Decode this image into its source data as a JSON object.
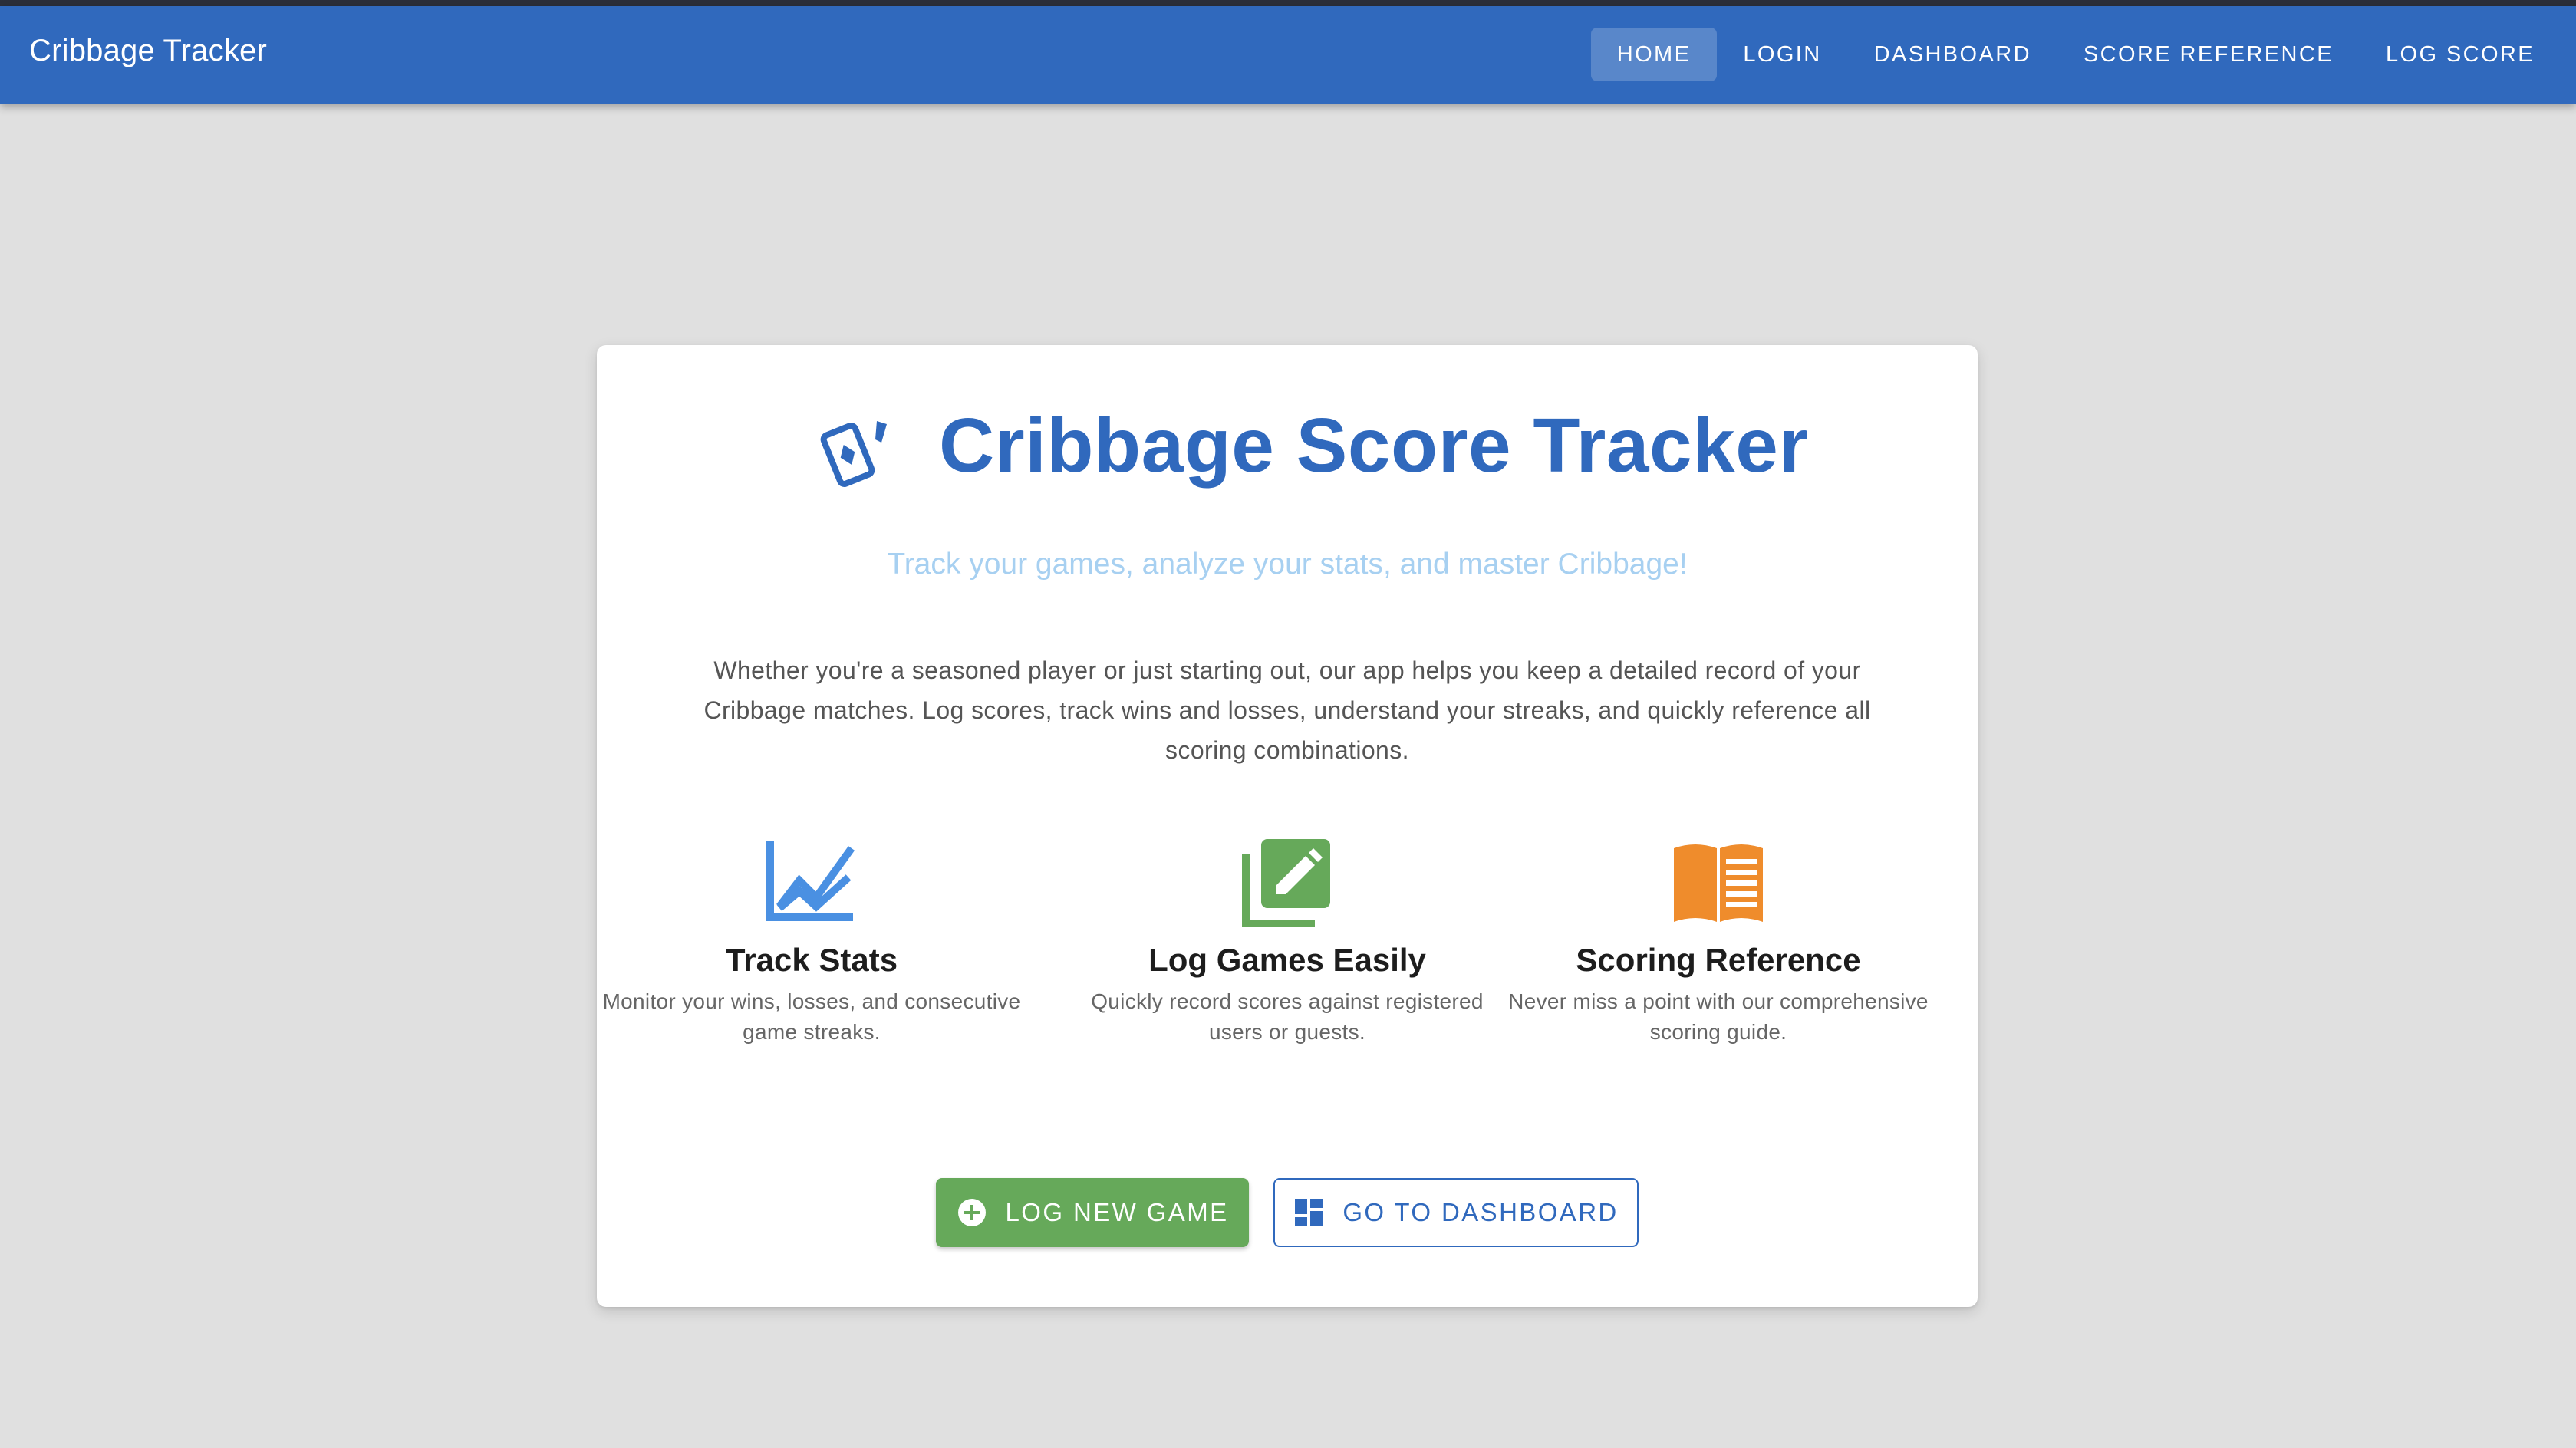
{
  "appbar": {
    "title": "Cribbage Tracker",
    "nav": [
      {
        "label": "Home",
        "active": true
      },
      {
        "label": "Login",
        "active": false
      },
      {
        "label": "Dashboard",
        "active": false
      },
      {
        "label": "Score Reference",
        "active": false
      },
      {
        "label": "Log Score",
        "active": false
      }
    ]
  },
  "hero": {
    "icon": "playing-cards-icon",
    "title": "Cribbage Score Tracker",
    "subtitle": "Track your games, analyze your stats, and master Cribbage!",
    "description": "Whether you're a seasoned player or just starting out, our app helps you keep a detailed record of your Cribbage matches. Log scores, track wins and losses, understand your streaks, and quickly reference all scoring combinations."
  },
  "features": [
    {
      "icon": "line-chart-icon",
      "title": "Track Stats",
      "description": "Monitor your wins, losses, and consecutive game streaks.",
      "color": "#4a90e2"
    },
    {
      "icon": "edit-note-icon",
      "title": "Log Games Easily",
      "description": "Quickly record scores against registered users or guests.",
      "color": "#66a95a"
    },
    {
      "icon": "book-icon",
      "title": "Scoring Reference",
      "description": "Never miss a point with our comprehensive scoring guide.",
      "color": "#ef8c2c"
    }
  ],
  "actions": {
    "primary": {
      "label": "Log New Game",
      "icon": "add-circle-icon"
    },
    "secondary": {
      "label": "Go to Dashboard",
      "icon": "dashboard-icon"
    }
  },
  "colors": {
    "primary": "#3069bd",
    "success": "#66a95a",
    "accent_orange": "#ef8c2c",
    "accent_blue": "#4a90e2",
    "background": "#e0e0e0"
  }
}
